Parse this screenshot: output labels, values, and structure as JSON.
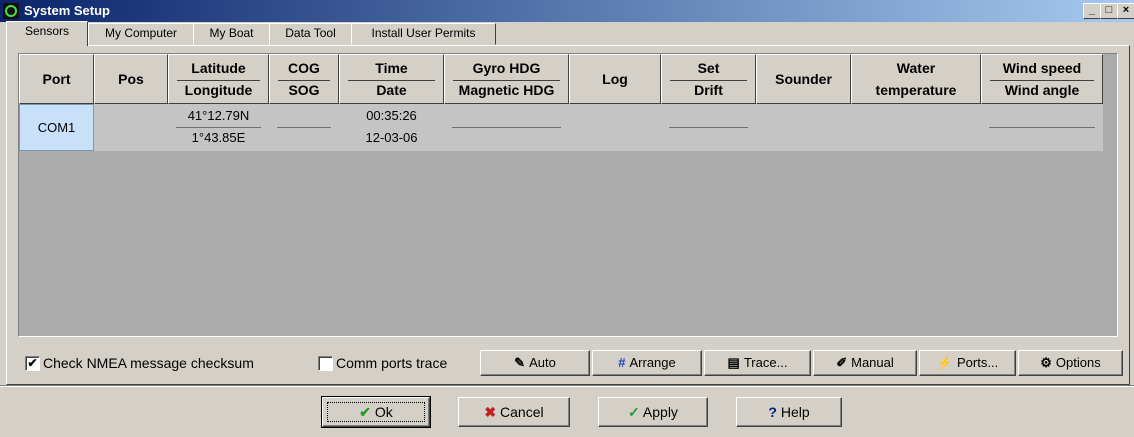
{
  "window": {
    "title": "System Setup",
    "controls": {
      "minimize": "_",
      "maximize": "□",
      "close": "×"
    },
    "icon": "lifebuoy-icon"
  },
  "tabs": [
    {
      "label": "Sensors",
      "active": true
    },
    {
      "label": "My Computer",
      "active": false
    },
    {
      "label": "My Boat",
      "active": false
    },
    {
      "label": "Data Tool",
      "active": false
    },
    {
      "label": "Install User Permits",
      "active": false
    }
  ],
  "sensors": {
    "headers": {
      "port": "Port",
      "pos": "Pos",
      "lat_top": "Latitude",
      "lat_bottom": "Longitude",
      "cog_top": "COG",
      "cog_bottom": "SOG",
      "time_top": "Time",
      "time_bottom": "Date",
      "gyro_top": "Gyro HDG",
      "gyro_bottom": "Magnetic HDG",
      "log": "Log",
      "set_top": "Set",
      "set_bottom": "Drift",
      "sounder": "Sounder",
      "water_top": "Water",
      "water_bottom": "temperature",
      "wind_top": "Wind speed",
      "wind_bottom": "Wind angle"
    },
    "rows": [
      {
        "port": "COM1",
        "latitude": "41°12.79N",
        "longitude": "1°43.85E",
        "time": "00:35:26",
        "date": "12-03-06"
      }
    ]
  },
  "options": {
    "checksum": {
      "label": "Check NMEA message checksum",
      "checked": true,
      "mark": "✔"
    },
    "trace": {
      "label": "Comm ports trace",
      "checked": false,
      "mark": ""
    }
  },
  "toolbar": {
    "auto": "Auto",
    "arrange": "Arrange",
    "trace": "Trace...",
    "manual": "Manual",
    "ports": "Ports...",
    "options": "Options"
  },
  "dialog": {
    "ok": "Ok",
    "cancel": "Cancel",
    "apply": "Apply",
    "help": "Help"
  },
  "colors": {
    "title_start": "#0a246a",
    "grid_bg": "#ababab",
    "port_cell": "#c8e0f8",
    "ok_check": "#2a9a2a",
    "cancel_x": "#c02020"
  }
}
